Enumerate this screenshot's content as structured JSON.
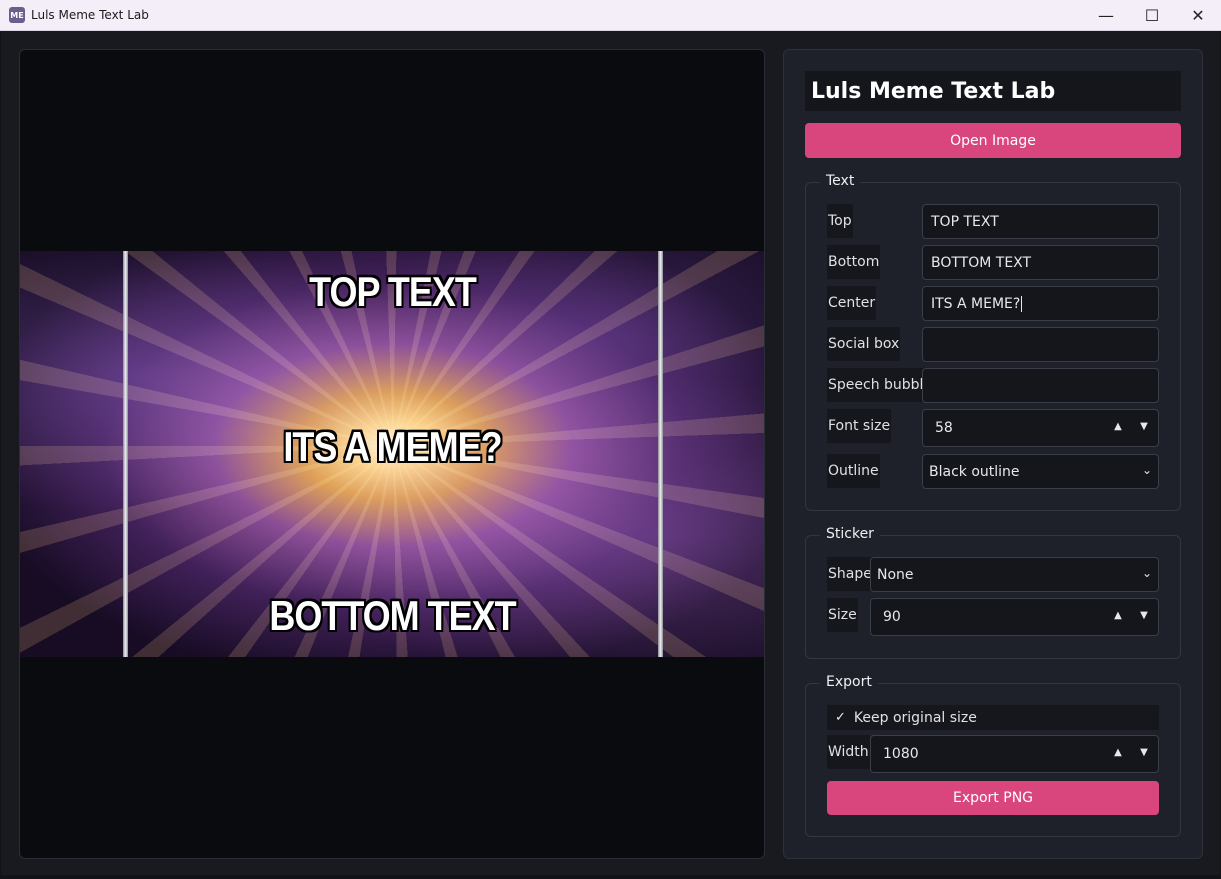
{
  "window": {
    "icon_text": "ME",
    "title": "Luls Meme Text Lab",
    "minimize": "—",
    "maximize": "☐",
    "close": "✕"
  },
  "preview": {
    "top_text": "TOP TEXT",
    "center_text": "ITS A MEME?",
    "bottom_text": "BOTTOM TEXT"
  },
  "controls": {
    "heading": "Luls Meme Text Lab",
    "open_image": "Open Image",
    "text_group": {
      "title": "Text",
      "top_label": "Top",
      "top_value": "TOP TEXT",
      "bottom_label": "Bottom",
      "bottom_value": "BOTTOM TEXT",
      "center_label": "Center",
      "center_value": "ITS A MEME?",
      "social_label": "Social box",
      "social_value": "",
      "speech_label": "Speech bubble",
      "speech_value": "",
      "font_size_label": "Font size",
      "font_size_value": "58",
      "outline_label": "Outline",
      "outline_value": "Black outline"
    },
    "sticker_group": {
      "title": "Sticker",
      "shape_label": "Shape",
      "shape_value": "None",
      "size_label": "Size",
      "size_value": "90"
    },
    "export_group": {
      "title": "Export",
      "keep_original": "Keep original size",
      "keep_original_checked": true,
      "width_label": "Width",
      "width_value": "1080",
      "export_button": "Export PNG"
    }
  },
  "colors": {
    "accent": "#d9457d",
    "panel": "#1e212a",
    "preview_bg": "#0a0b0f"
  }
}
